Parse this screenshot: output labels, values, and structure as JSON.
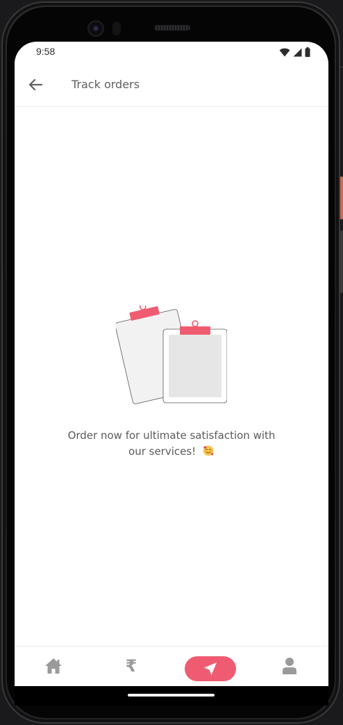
{
  "status_bar": {
    "time": "9:58",
    "icons": [
      "wifi-icon",
      "signal-icon",
      "battery-icon"
    ]
  },
  "app_bar": {
    "back_icon": "arrow-left-icon",
    "title": "Track orders"
  },
  "empty_state": {
    "illustration": "clipboards-icon",
    "message": "Order now for ultimate satisfaction with our services!",
    "emoji": "smiling-face-with-hearts-icon"
  },
  "bottom_nav": {
    "items": [
      {
        "icon": "home-icon",
        "active": false
      },
      {
        "icon": "rupee-icon",
        "label": "₹",
        "active": false
      },
      {
        "icon": "navigation-arrow-icon",
        "active": true
      },
      {
        "icon": "user-icon",
        "active": false
      }
    ],
    "active_color": "#ef5c71",
    "inactive_color": "#9a9a9a"
  },
  "colors": {
    "accent": "#ef5c71",
    "title_text": "#5f5f5f",
    "body_text": "#5a5a5a"
  }
}
